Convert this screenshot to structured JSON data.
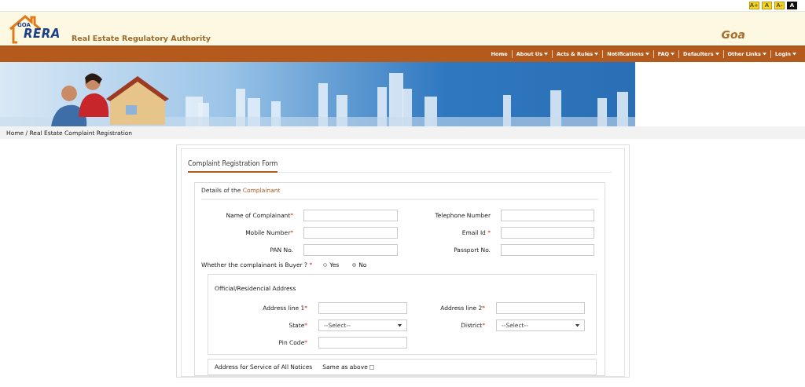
{
  "font_size_buttons": [
    {
      "label": "A+",
      "selected": false
    },
    {
      "label": "A",
      "selected": false
    },
    {
      "label": "A-",
      "selected": false
    },
    {
      "label": "A",
      "selected": true
    }
  ],
  "header": {
    "logo_small": "GOA",
    "logo_main": "RERA",
    "authority": "Real Estate Regulatory Authority",
    "state": "Goa"
  },
  "nav": [
    {
      "label": "Home",
      "dropdown": false
    },
    {
      "label": "About Us",
      "dropdown": true
    },
    {
      "label": "Acts & Rules",
      "dropdown": true
    },
    {
      "label": "Notifications",
      "dropdown": true
    },
    {
      "label": "FAQ",
      "dropdown": true
    },
    {
      "label": "Defaulters",
      "dropdown": true
    },
    {
      "label": "Other Links",
      "dropdown": true
    },
    {
      "label": "Login",
      "dropdown": true
    }
  ],
  "breadcrumb": "Home / Real Estate Complaint Registration",
  "form": {
    "title": "Complaint Registration Form",
    "section": {
      "title": "Details of the ",
      "title_highlight": "Complainant",
      "fields": [
        {
          "label": "Name of Complainant",
          "mark": "*",
          "kind": "text"
        },
        {
          "label": "Telephone Number",
          "kind": "text"
        },
        {
          "label": "Mobile Number",
          "mark": "*",
          "kind": "text"
        },
        {
          "label": "Email Id ",
          "mark": "*",
          "kind": "text"
        },
        {
          "label": "PAN No.",
          "kind": "text"
        },
        {
          "label": "Passport No.",
          "kind": "text"
        }
      ],
      "buyer_question": {
        "label": "Whether the complainant is Buyer ? ",
        "mark": "*",
        "options": [
          {
            "label": "Yes",
            "selected": false
          },
          {
            "label": "No",
            "selected": true
          }
        ]
      },
      "address": {
        "title": "Official/Residencial Address",
        "fields": [
          {
            "label": "Address line 1",
            "mark": "*",
            "kind": "text"
          },
          {
            "label": "Address line 2",
            "mark": "*",
            "kind": "text"
          },
          {
            "label": "State",
            "mark": "*",
            "kind": "select",
            "value": "--Select--"
          },
          {
            "label": "District",
            "mark": "*",
            "kind": "select",
            "value": "--Select--"
          },
          {
            "label": "Pin Code",
            "mark": "*",
            "kind": "text"
          }
        ]
      },
      "notice_address": {
        "title": "Address for Service of All Notices",
        "same_as_above": {
          "label": "Same as above",
          "checked": false
        }
      }
    }
  }
}
